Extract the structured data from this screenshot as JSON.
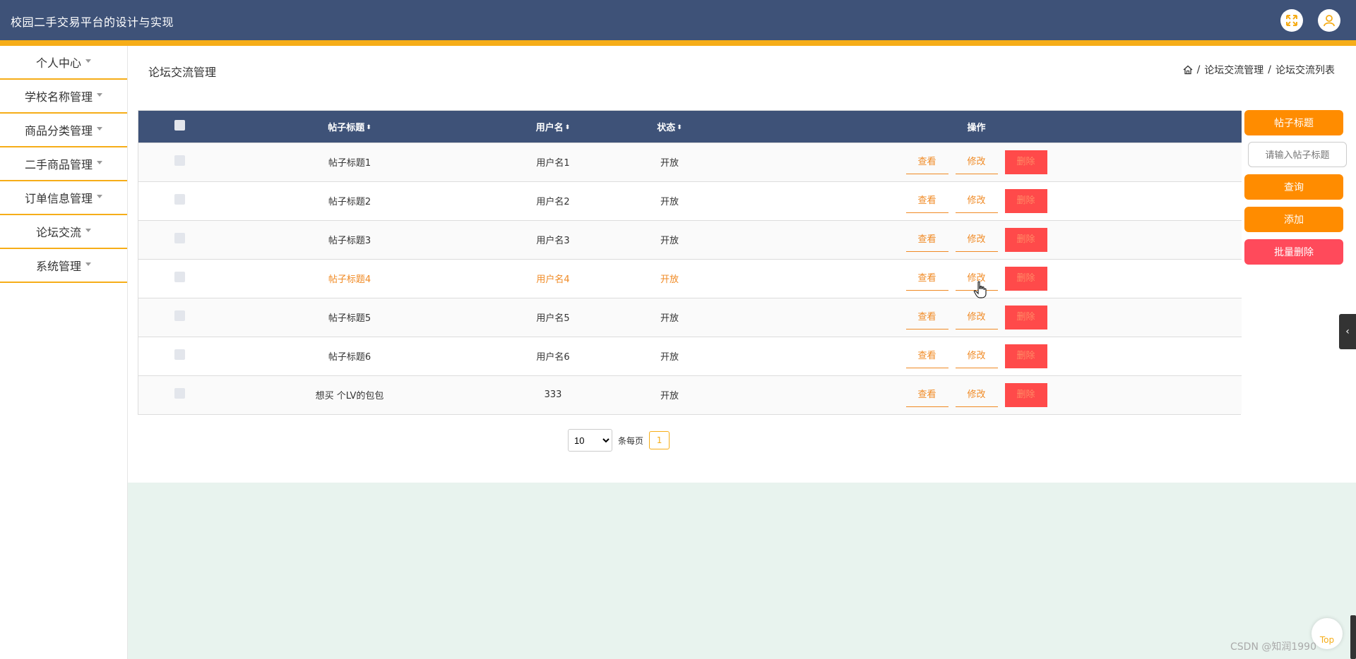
{
  "header": {
    "title": "校园二手交易平台的设计与实现"
  },
  "sidebar": {
    "items": [
      {
        "label": "个人中心"
      },
      {
        "label": "学校名称管理"
      },
      {
        "label": "商品分类管理"
      },
      {
        "label": "二手商品管理"
      },
      {
        "label": "订单信息管理"
      },
      {
        "label": "论坛交流"
      },
      {
        "label": "系统管理"
      }
    ]
  },
  "page": {
    "title": "论坛交流管理",
    "breadcrumb": {
      "sep": "/",
      "crumb1": "论坛交流管理",
      "crumb2": "论坛交流列表"
    }
  },
  "table": {
    "columns": {
      "title": "帖子标题",
      "username": "用户名",
      "status": "状态",
      "actions": "操作",
      "sort_icon": "⬍"
    },
    "action_labels": {
      "view": "查看",
      "edit": "修改",
      "delete": "删除"
    },
    "rows": [
      {
        "title": "帖子标题1",
        "username": "用户名1",
        "status": "开放"
      },
      {
        "title": "帖子标题2",
        "username": "用户名2",
        "status": "开放"
      },
      {
        "title": "帖子标题3",
        "username": "用户名3",
        "status": "开放"
      },
      {
        "title": "帖子标题4",
        "username": "用户名4",
        "status": "开放"
      },
      {
        "title": "帖子标题5",
        "username": "用户名5",
        "status": "开放"
      },
      {
        "title": "帖子标题6",
        "username": "用户名6",
        "status": "开放"
      },
      {
        "title": "想买 个LV的包包",
        "username": "333",
        "status": "开放"
      }
    ]
  },
  "pagination": {
    "page_size": "10",
    "per_page_label": "条每页",
    "current_page": "1"
  },
  "search_panel": {
    "field_label": "帖子标题",
    "placeholder": "请输入帖子标题",
    "query_button": "查询",
    "add_button": "添加",
    "batch_delete_button": "批量删除"
  },
  "widgets": {
    "top_label": "Top",
    "side_toggle": "‹"
  },
  "watermark": "CSDN @知润1990",
  "colors": {
    "header_bg": "#3e5278",
    "accent": "#f6ad18",
    "action_orange": "#ff8c00",
    "danger_red": "#ff4a5b",
    "highlight_text": "#f08a24"
  }
}
